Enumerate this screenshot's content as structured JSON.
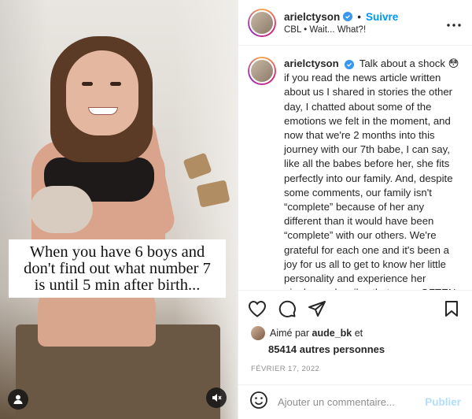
{
  "media": {
    "caption_lines": [
      "When you have 6 boys and",
      "don't find out what number 7",
      "is until 5 min after birth..."
    ],
    "user_tag_icon": "user-icon",
    "mute_icon": "muted-speaker-icon"
  },
  "header": {
    "username": "arielctyson",
    "verified_icon": "verified-badge-icon",
    "separator": "•",
    "follow_label": "Suivre",
    "subtitle": "CBL • Wait... What?!",
    "more_icon": "more-options-icon"
  },
  "post": {
    "username": "arielctyson",
    "caption": "Talk about a shock 😳 if you read the news article written about us I shared in stories the other day, I chatted about some of the emotions we felt in the moment, and now that we're 2 months into this journey with our 7th babe, I can say, like all the babes before her, she fits perfectly into our family. And, despite some comments, our family isn't “complete” because of her any different than it would have been “complete” with our others. We're grateful for each one and it's been a joy for us all to get to know her little personality and experience her giggles and smiles that come OFTEN"
  },
  "actions": {
    "like_icon": "heart-icon",
    "comment_icon": "comment-icon",
    "share_icon": "share-icon",
    "save_icon": "bookmark-icon"
  },
  "likes": {
    "prefix": "Aimé par",
    "user": "aude_bk",
    "suffix": "et",
    "others": "85414 autres personnes"
  },
  "date": "FÉVRIER 17, 2022",
  "comment_box": {
    "emoji_icon": "emoji-icon",
    "placeholder": "Ajouter un commentaire...",
    "publish_label": "Publier"
  }
}
